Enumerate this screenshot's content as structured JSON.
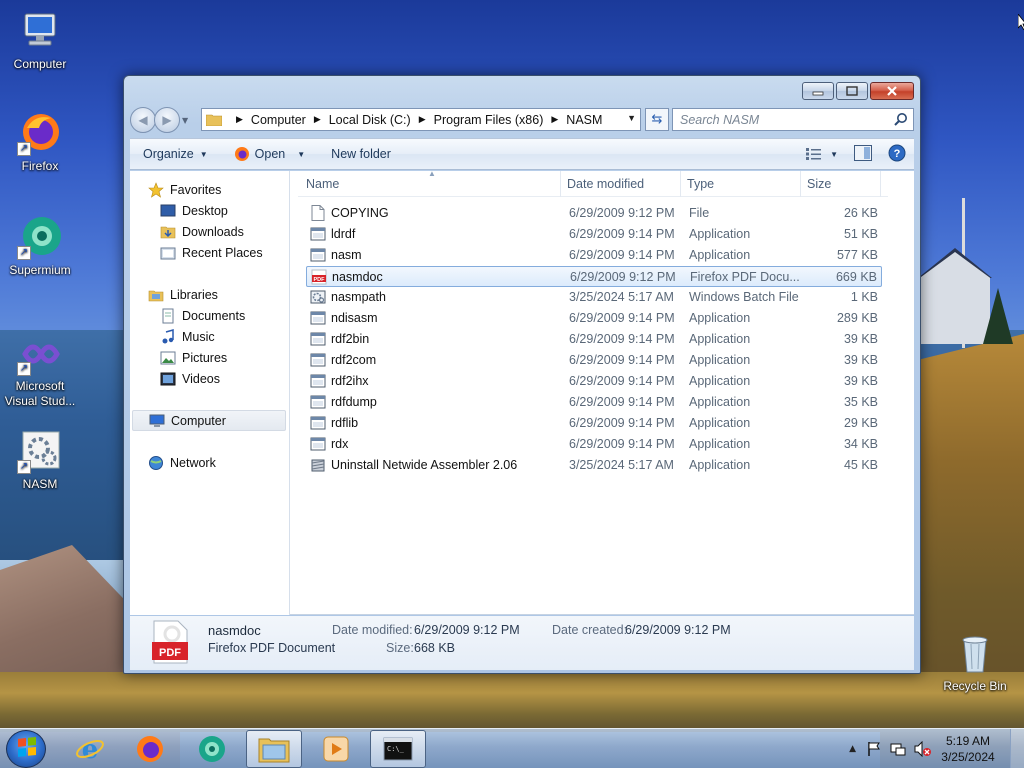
{
  "desktop": {
    "icons": [
      {
        "label": "Computer"
      },
      {
        "label": "Firefox"
      },
      {
        "label": "Supermium"
      },
      {
        "label": "Microsoft Visual Stud..."
      },
      {
        "label": "NASM"
      },
      {
        "label": "Recycle Bin"
      }
    ]
  },
  "window": {
    "address": {
      "crumbs": [
        "Computer",
        "Local Disk (C:)",
        "Program Files (x86)",
        "NASM"
      ]
    },
    "search": {
      "placeholder": "Search NASM"
    },
    "toolbar": {
      "organize": "Organize",
      "open": "Open",
      "new_folder": "New folder"
    },
    "nav": {
      "favorites": "Favorites",
      "desktop": "Desktop",
      "downloads": "Downloads",
      "recent_places": "Recent Places",
      "libraries": "Libraries",
      "documents": "Documents",
      "music": "Music",
      "pictures": "Pictures",
      "videos": "Videos",
      "computer": "Computer",
      "network": "Network"
    },
    "columns": {
      "name": "Name",
      "date_modified": "Date modified",
      "type": "Type",
      "size": "Size"
    },
    "files": [
      {
        "name": "COPYING",
        "date": "6/29/2009 9:12 PM",
        "type": "File",
        "size": "26 KB",
        "icon": "blank-file-icon"
      },
      {
        "name": "ldrdf",
        "date": "6/29/2009 9:14 PM",
        "type": "Application",
        "size": "51 KB",
        "icon": "application-icon"
      },
      {
        "name": "nasm",
        "date": "6/29/2009 9:14 PM",
        "type": "Application",
        "size": "577 KB",
        "icon": "application-icon"
      },
      {
        "name": "nasmdoc",
        "date": "6/29/2009 9:12 PM",
        "type": "Firefox PDF Docu...",
        "size": "669 KB",
        "icon": "pdf-icon"
      },
      {
        "name": "nasmpath",
        "date": "3/25/2024 5:17 AM",
        "type": "Windows Batch File",
        "size": "1 KB",
        "icon": "batch-file-icon"
      },
      {
        "name": "ndisasm",
        "date": "6/29/2009 9:14 PM",
        "type": "Application",
        "size": "289 KB",
        "icon": "application-icon"
      },
      {
        "name": "rdf2bin",
        "date": "6/29/2009 9:14 PM",
        "type": "Application",
        "size": "39 KB",
        "icon": "application-icon"
      },
      {
        "name": "rdf2com",
        "date": "6/29/2009 9:14 PM",
        "type": "Application",
        "size": "39 KB",
        "icon": "application-icon"
      },
      {
        "name": "rdf2ihx",
        "date": "6/29/2009 9:14 PM",
        "type": "Application",
        "size": "39 KB",
        "icon": "application-icon"
      },
      {
        "name": "rdfdump",
        "date": "6/29/2009 9:14 PM",
        "type": "Application",
        "size": "35 KB",
        "icon": "application-icon"
      },
      {
        "name": "rdflib",
        "date": "6/29/2009 9:14 PM",
        "type": "Application",
        "size": "29 KB",
        "icon": "application-icon"
      },
      {
        "name": "rdx",
        "date": "6/29/2009 9:14 PM",
        "type": "Application",
        "size": "34 KB",
        "icon": "application-icon"
      },
      {
        "name": "Uninstall Netwide Assembler 2.06",
        "date": "3/25/2024 5:17 AM",
        "type": "Application",
        "size": "45 KB",
        "icon": "uninstaller-icon"
      }
    ],
    "selected_file": "nasmdoc",
    "details": {
      "name": "nasmdoc",
      "type": "Firefox PDF Document",
      "date_modified_label": "Date modified:",
      "date_modified": "6/29/2009 9:12 PM",
      "size_label": "Size:",
      "size": "668 KB",
      "date_created_label": "Date created:",
      "date_created": "6/29/2009 9:12 PM"
    }
  },
  "taskbar": {
    "time": "5:19 AM",
    "date": "3/25/2024"
  },
  "colors": {
    "accent": "#2c6bc8",
    "selection_border": "#84acdd",
    "pdf_red": "#d8232a"
  }
}
